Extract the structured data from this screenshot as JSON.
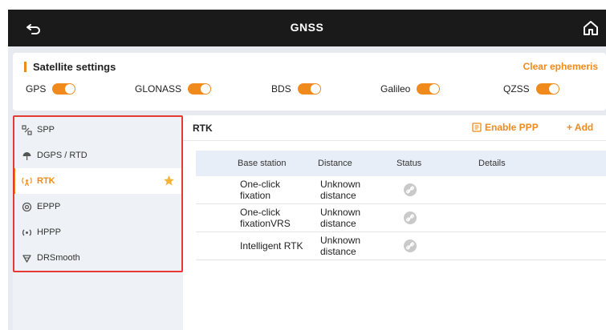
{
  "titlebar": {
    "title": "GNSS"
  },
  "satellite_settings": {
    "title": "Satellite settings",
    "clear_label": "Clear ephemeris",
    "systems": [
      {
        "label": "GPS",
        "enabled": true
      },
      {
        "label": "GLONASS",
        "enabled": true
      },
      {
        "label": "BDS",
        "enabled": true
      },
      {
        "label": "Galileo",
        "enabled": true
      },
      {
        "label": "QZSS",
        "enabled": true
      }
    ]
  },
  "nav": {
    "items": [
      {
        "label": "SPP",
        "icon": "satellite-icon"
      },
      {
        "label": "DGPS / RTD",
        "icon": "antenna-icon"
      },
      {
        "label": "RTK",
        "icon": "signal-tower-icon",
        "active": true,
        "favorite": true
      },
      {
        "label": "EPPP",
        "icon": "ring-antenna-icon"
      },
      {
        "label": "HPPP",
        "icon": "broadcast-icon"
      },
      {
        "label": "DRSmooth",
        "icon": "down-triangle-icon"
      }
    ]
  },
  "panel": {
    "title": "RTK",
    "enable_ppp_label": "Enable PPP",
    "add_label": "+ Add",
    "columns": [
      "Base station",
      "Distance",
      "Status",
      "Details"
    ],
    "rows": [
      {
        "base": "One-click fixation",
        "distance": "Unknown distance",
        "status": "link-icon"
      },
      {
        "base": "One-click fixationVRS",
        "distance": "Unknown distance",
        "status": "link-icon"
      },
      {
        "base": "Intelligent RTK",
        "distance": "Unknown distance",
        "status": "link-icon"
      }
    ]
  },
  "colors": {
    "accent": "#f08a1c",
    "titlebar": "#1a1a1a",
    "highlight_box": "#e53935",
    "table_header": "#e8eef7"
  }
}
